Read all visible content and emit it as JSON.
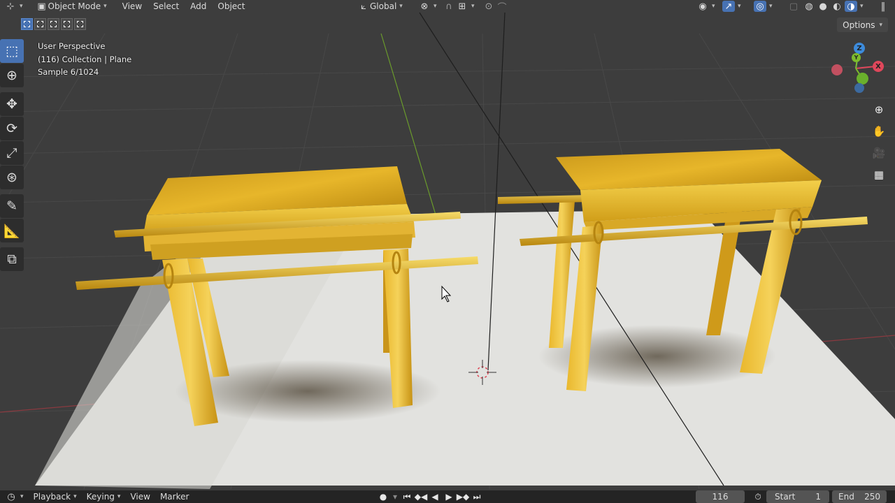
{
  "header": {
    "editor_type_icon": "axis-editor-icon",
    "mode_label": "Object Mode",
    "menus": [
      "View",
      "Select",
      "Add",
      "Object"
    ],
    "orientation_label": "Global",
    "pivot_icon": "pivot-icon",
    "snap_icon": "magnet-icon",
    "snap_target_icon": "snap-increment-icon",
    "proportional_icon": "proportional-icon",
    "falloff_icon": "falloff-curve-icon"
  },
  "subheader": {
    "options_label": "Options"
  },
  "overlay_info": {
    "perspective": "User Perspective",
    "collection": "(116) Collection | Plane",
    "sample": "Sample 6/1024"
  },
  "gizmo": {
    "x_label": "X",
    "y_label": "Y",
    "z_label": "Z"
  },
  "toolbar": {
    "tools": [
      "select-box-icon",
      "cursor-icon",
      "move-icon",
      "rotate-icon",
      "scale-icon",
      "transform-icon",
      "annotate-icon",
      "measure-icon",
      "add-cube-icon"
    ]
  },
  "timeline": {
    "menus": [
      "Playback",
      "Keying",
      "View",
      "Marker"
    ],
    "current_frame": "116",
    "start_label": "Start",
    "start_value": "1",
    "end_label": "End",
    "end_value": "250"
  },
  "colors": {
    "accent": "#4772b3",
    "gold": "#d9a91a",
    "floor": "#dcdcd8",
    "background": "#3d3d3d",
    "axis_x": "#e0475b",
    "axis_y": "#7dbb2c",
    "axis_z": "#3d8bdb"
  }
}
